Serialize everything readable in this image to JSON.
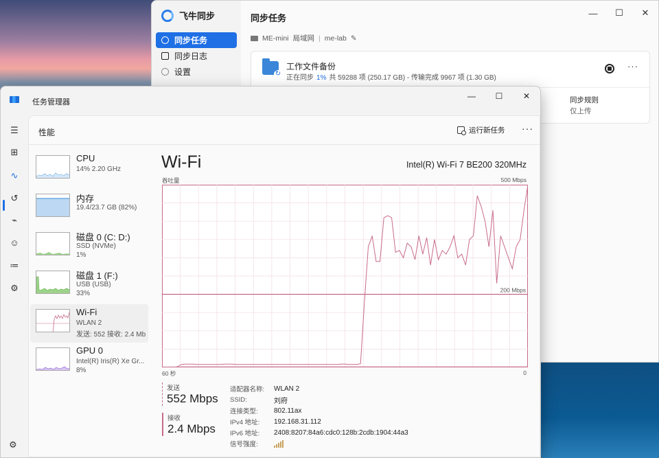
{
  "sync_app": {
    "brand": "飞牛同步",
    "nav": [
      {
        "label": "同步任务",
        "active": true
      },
      {
        "label": "同步日志",
        "active": false
      },
      {
        "label": "设置",
        "active": false
      }
    ],
    "title": "同步任务",
    "window_controls": {
      "minimize": "—",
      "maximize": "☐",
      "close": "✕"
    },
    "device": {
      "name": "ME-mini",
      "network": "局域网",
      "account": "me-lab",
      "edit_icon": "✎"
    },
    "task": {
      "name": "工作文件备份",
      "status_prefix": "正在同步",
      "percent": "1%",
      "status_detail": "共 59288 项 (250.17 GB) - 传输完成 9967 项 (1.30 GB)",
      "more": "···",
      "rule_label": "同步规则",
      "rule_value": "仅上传"
    }
  },
  "task_manager": {
    "title": "任务管理器",
    "window_controls": {
      "minimize": "—",
      "maximize": "☐",
      "close": "✕"
    },
    "rail_icons": [
      "☰",
      "⊞",
      "∿",
      "↺",
      "⌁",
      "☺",
      "≔",
      "⚙"
    ],
    "header": {
      "title": "性能",
      "run_task": "运行新任务",
      "more": "···"
    },
    "perf_items": [
      {
        "name": "CPU",
        "line1": "14%  2.20 GHz",
        "line2": "",
        "color": "#3a8bd4"
      },
      {
        "name": "内存",
        "line1": "19.4/23.7 GB (82%)",
        "line2": "",
        "color": "#3a8bd4"
      },
      {
        "name": "磁盘 0 (C: D:)",
        "line1": "SSD (NVMe)",
        "line2": "1%",
        "color": "#5ab046"
      },
      {
        "name": "磁盘 1 (F:)",
        "line1": "USB (USB)",
        "line2": "33%",
        "color": "#5ab046"
      },
      {
        "name": "Wi-Fi",
        "line1": "WLAN 2",
        "line2": "发送: 552  接收: 2.4 Mb",
        "color": "#c86a8a"
      },
      {
        "name": "GPU 0",
        "line1": "Intel(R) Iris(R) Xe Gr...",
        "line2": "8%",
        "color": "#8a5ad0"
      }
    ],
    "detail": {
      "title": "Wi-Fi",
      "adapter": "Intel(R) Wi-Fi 7 BE200 320MHz",
      "throughput_label": "吞吐量",
      "max_label": "500 Mbps",
      "time_left": "60 秒",
      "time_right": "0",
      "send_label": "发送",
      "send_value": "552 Mbps",
      "recv_label": "接收",
      "recv_value": "2.4 Mbps",
      "properties": [
        {
          "key": "适配器名称:",
          "value": "WLAN 2"
        },
        {
          "key": "SSID:",
          "value": "刘府"
        },
        {
          "key": "连接类型:",
          "value": "802.11ax"
        },
        {
          "key": "IPv4 地址:",
          "value": "192.168.31.112"
        },
        {
          "key": "IPv6 地址:",
          "value": "2408:8207:84a6:cdc0:128b:2cdb:1904:44a3"
        },
        {
          "key": "信号强度:",
          "value": ""
        }
      ]
    },
    "chart_data": {
      "type": "line",
      "ylim": [
        0,
        500
      ],
      "y_unit": "Mbps",
      "reference_line_label": "200 Mbps",
      "reference_line_value": 200,
      "x_range_seconds": [
        60,
        0
      ],
      "series": [
        {
          "color": "#c86a8a",
          "values": [
            0,
            0,
            0,
            0,
            2,
            8,
            9,
            9,
            9,
            8,
            8,
            8,
            8,
            8,
            8,
            8,
            9,
            9,
            9,
            8,
            8,
            8,
            8,
            8,
            8,
            8,
            8,
            8,
            8,
            8,
            8,
            8,
            8,
            8,
            8,
            8,
            8,
            8,
            8,
            8,
            8,
            8,
            8,
            8,
            8,
            8,
            9,
            9,
            8,
            8,
            8,
            10,
            180,
            330,
            360,
            290,
            290,
            410,
            415,
            410,
            315,
            320,
            300,
            340,
            330,
            295,
            360,
            310,
            355,
            280,
            350,
            295,
            320,
            310,
            330,
            360,
            300,
            310,
            280,
            350,
            360,
            470,
            440,
            400,
            330,
            430,
            230,
            360,
            330,
            300,
            270,
            330,
            350,
            430,
            500
          ]
        },
        {
          "color": "#c86a8a",
          "values": [
            0,
            0,
            0,
            0,
            0,
            1,
            1,
            1,
            1,
            1,
            1,
            1,
            1,
            1,
            1,
            1,
            1,
            1,
            1,
            1,
            1,
            1,
            1,
            1,
            1,
            1,
            1,
            1,
            1,
            1,
            1,
            1,
            1,
            1,
            1,
            1,
            1,
            1,
            1,
            1,
            1,
            1,
            1,
            1,
            1,
            1,
            1,
            1,
            1,
            1,
            1,
            1,
            1,
            1,
            1,
            1,
            1,
            1,
            1,
            1,
            1,
            1,
            1,
            1,
            1,
            1,
            1,
            1,
            1,
            1,
            1,
            1,
            1,
            1,
            1,
            1,
            1,
            1,
            1,
            1,
            1,
            1,
            1,
            1,
            1,
            1,
            1,
            1,
            1,
            1,
            1,
            1,
            1,
            1,
            1
          ]
        }
      ]
    }
  }
}
